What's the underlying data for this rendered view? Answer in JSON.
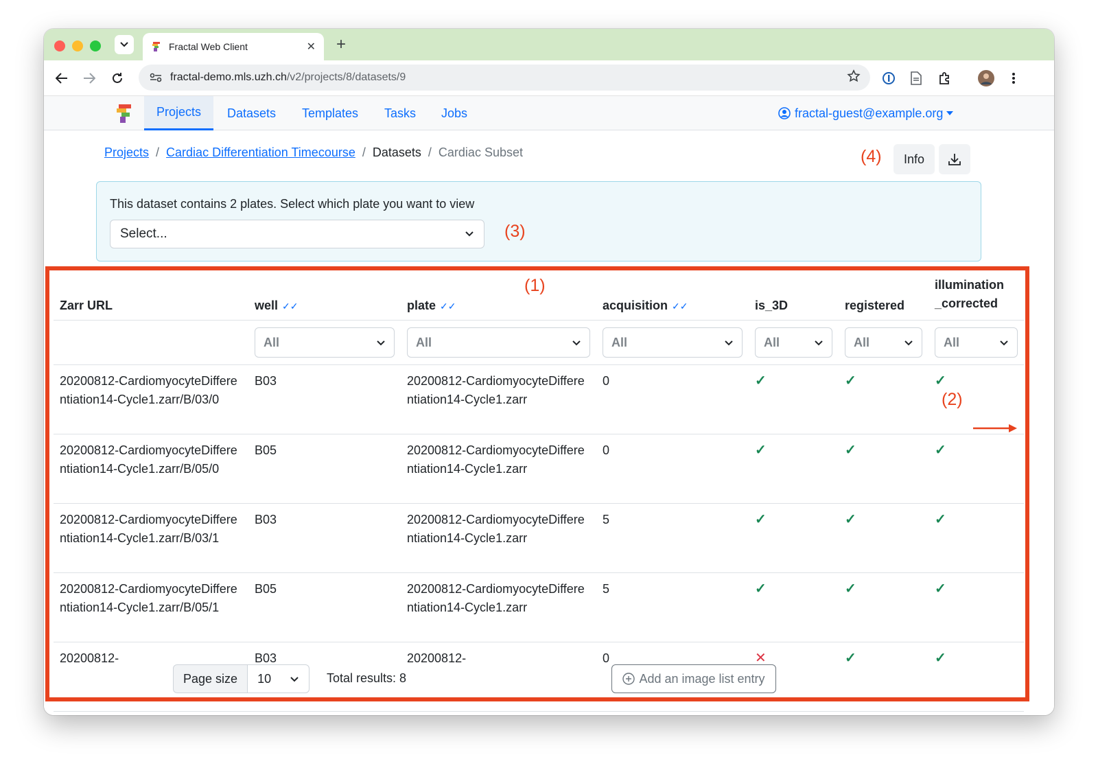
{
  "browser": {
    "tab_title": "Fractal Web Client",
    "url_host": "fractal-demo.mls.uzh.ch",
    "url_path": "/v2/projects/8/datasets/9"
  },
  "nav": {
    "items": [
      "Projects",
      "Datasets",
      "Templates",
      "Tasks",
      "Jobs"
    ],
    "active": "Projects",
    "user": "fractal-guest@example.org"
  },
  "breadcrumb": {
    "projects": "Projects",
    "project": "Cardiac Differentiation Timecourse",
    "datasets": "Datasets",
    "dataset": "Cardiac Subset"
  },
  "actions": {
    "info": "Info"
  },
  "plate_selector": {
    "message": "This dataset contains 2 plates. Select which plate you want to view",
    "placeholder": "Select..."
  },
  "annotations": {
    "a1": "(1)",
    "a2": "(2)",
    "a3": "(3)",
    "a4": "(4)"
  },
  "table": {
    "headers": {
      "zarr": "Zarr URL",
      "well": "well",
      "plate": "plate",
      "acquisition": "acquisition",
      "is3d": "is_3D",
      "registered": "registered",
      "illum1": "illumination",
      "illum2": "_corrected"
    },
    "filter_all": "All",
    "rows": [
      {
        "zarr": "20200812-CardiomyocyteDifferentiation14-Cycle1.zarr/B/03/0",
        "well": "B03",
        "plate": "20200812-CardiomyocyteDifferentiation14-Cycle1.zarr",
        "acquisition": "0",
        "is3d": true,
        "registered": true,
        "illum": true
      },
      {
        "zarr": "20200812-CardiomyocyteDifferentiation14-Cycle1.zarr/B/05/0",
        "well": "B05",
        "plate": "20200812-CardiomyocyteDifferentiation14-Cycle1.zarr",
        "acquisition": "0",
        "is3d": true,
        "registered": true,
        "illum": true
      },
      {
        "zarr": "20200812-CardiomyocyteDifferentiation14-Cycle1.zarr/B/03/1",
        "well": "B03",
        "plate": "20200812-CardiomyocyteDifferentiation14-Cycle1.zarr",
        "acquisition": "5",
        "is3d": true,
        "registered": true,
        "illum": true
      },
      {
        "zarr": "20200812-CardiomyocyteDifferentiation14-Cycle1.zarr/B/05/1",
        "well": "B05",
        "plate": "20200812-CardiomyocyteDifferentiation14-Cycle1.zarr",
        "acquisition": "5",
        "is3d": true,
        "registered": true,
        "illum": true
      },
      {
        "zarr": "20200812-",
        "well": "B03",
        "plate": "20200812-",
        "acquisition": "0",
        "is3d": false,
        "registered": true,
        "illum": true
      }
    ]
  },
  "pagination": {
    "page_size_label": "Page size",
    "page_size": "10",
    "total": "Total results: 8"
  },
  "add_button": "Add an image list entry"
}
